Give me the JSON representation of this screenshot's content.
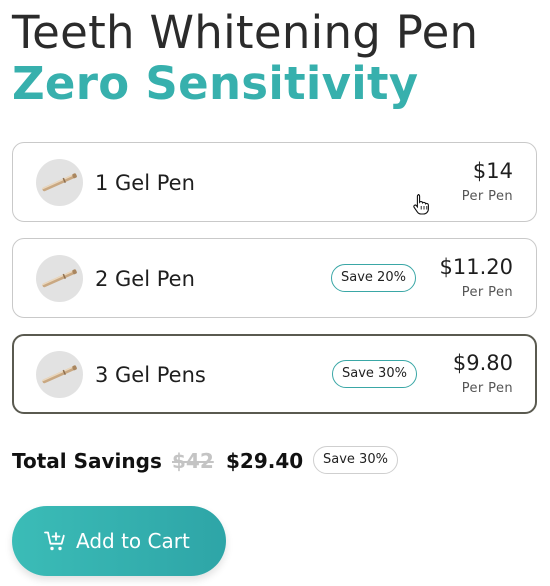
{
  "header": {
    "title": "Teeth Whitening Pen",
    "subtitle": "Zero Sensitivity"
  },
  "options": [
    {
      "label": "1 Gel Pen",
      "price": "$14",
      "per": "Per Pen",
      "badge": "",
      "selected": false
    },
    {
      "label": "2 Gel Pen",
      "price": "$11.20",
      "per": "Per Pen",
      "badge": "Save 20%",
      "selected": false
    },
    {
      "label": "3 Gel Pens",
      "price": "$9.80",
      "per": "Per Pen",
      "badge": "Save 30%",
      "selected": true
    }
  ],
  "savings": {
    "label": "Total Savings",
    "old_price": "$42",
    "new_price": "$29.40",
    "badge": "Save 30%"
  },
  "cart": {
    "label": "Add to Cart",
    "icon": "cart-plus-icon"
  },
  "colors": {
    "accent": "#37b0ad",
    "selected_border": "#5a5a50",
    "badge_border": "#3aa7a6"
  }
}
